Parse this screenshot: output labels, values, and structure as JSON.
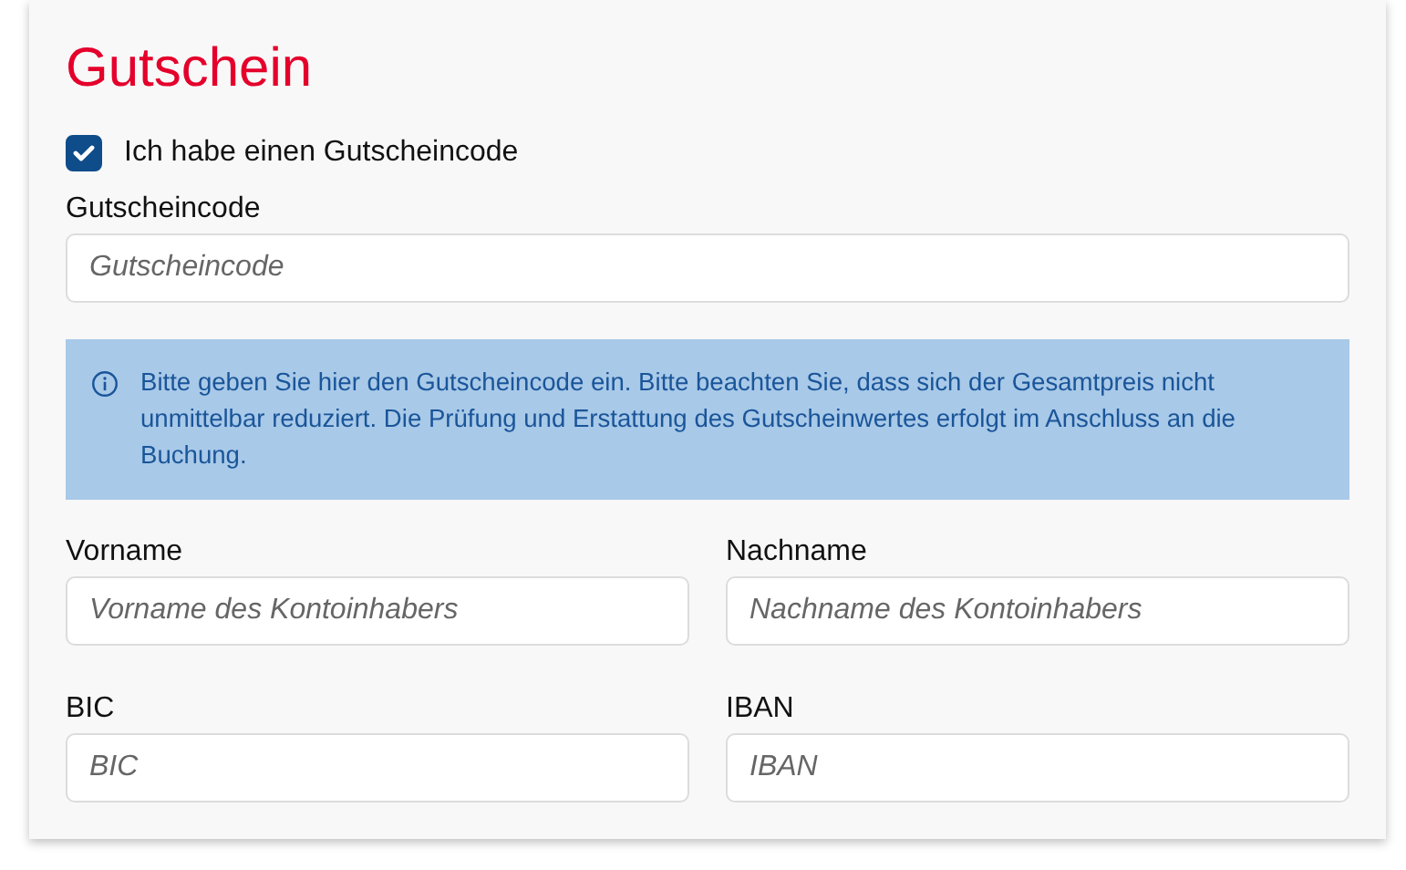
{
  "title": "Gutschein",
  "voucher_checkbox": {
    "label": "Ich habe einen Gutscheincode",
    "checked": true
  },
  "code_field": {
    "label": "Gutscheincode",
    "placeholder": "Gutscheincode"
  },
  "info": {
    "text": "Bitte geben Sie hier den Gutscheincode ein. Bitte beachten Sie, dass sich der Gesamtpreis nicht unmittelbar reduziert. Die Prüfung und Erstattung des Gutscheinwertes erfolgt im Anschluss an die Buchung."
  },
  "fields": [
    {
      "label": "Vorname",
      "placeholder": "Vorname des Kontoinhabers"
    },
    {
      "label": "Nachname",
      "placeholder": "Nachname des Kontoinhabers"
    },
    {
      "label": "BIC",
      "placeholder": "BIC"
    },
    {
      "label": "IBAN",
      "placeholder": "IBAN"
    }
  ]
}
